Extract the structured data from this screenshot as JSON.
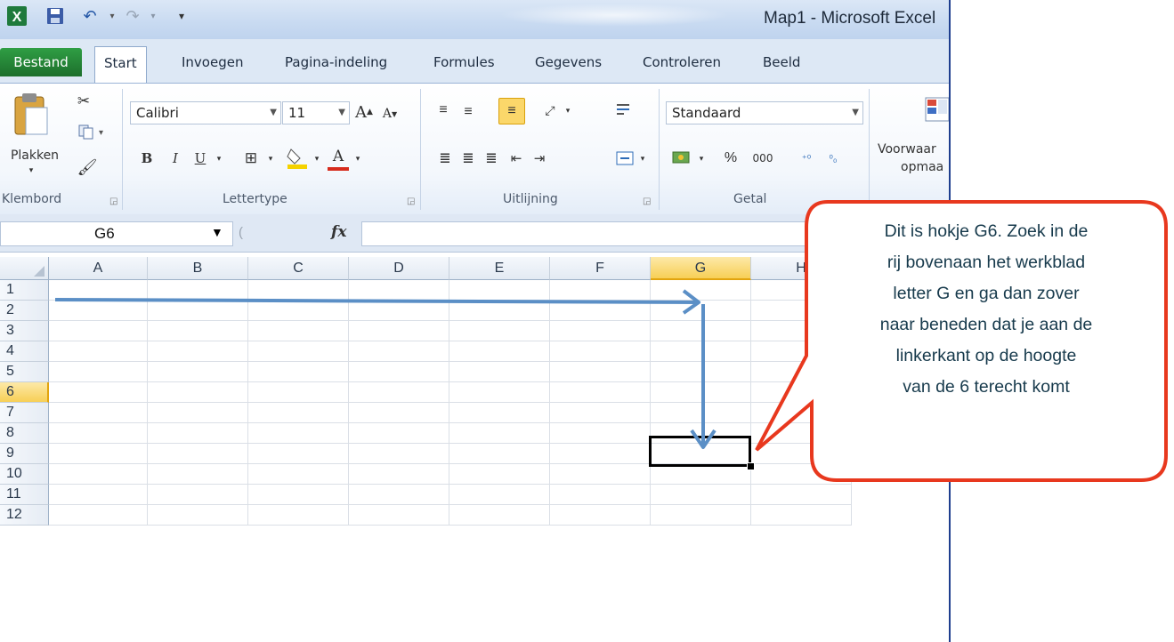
{
  "window": {
    "title": "Map1 - Microsoft Excel"
  },
  "quick_access": {
    "undo_icon": "undo-icon",
    "redo_icon": "redo-icon",
    "save_icon": "save-icon",
    "app_icon": "excel-icon",
    "customize": "▾"
  },
  "tabs": [
    {
      "label": "Bestand",
      "active": false,
      "file": true
    },
    {
      "label": "Start",
      "active": true
    },
    {
      "label": "Invoegen"
    },
    {
      "label": "Pagina-indeling"
    },
    {
      "label": "Formules"
    },
    {
      "label": "Gegevens"
    },
    {
      "label": "Controleren"
    },
    {
      "label": "Beeld"
    }
  ],
  "ribbon": {
    "clipboard": {
      "paste_label": "Plakken",
      "group_label": "Klembord"
    },
    "font": {
      "name": "Calibri",
      "size": "11",
      "bold": "B",
      "italic": "I",
      "underline": "U",
      "grow": "A",
      "shrink": "A",
      "color_a": "A",
      "group_label": "Lettertype"
    },
    "alignment": {
      "group_label": "Uitlijning"
    },
    "number": {
      "format": "Standaard",
      "percent": "%",
      "thousands": "000",
      "group_label": "Getal"
    },
    "styles": {
      "conditional_label_1": "Voorwaar",
      "conditional_label_2": "opmaa"
    }
  },
  "formula_bar": {
    "name_box": "G6",
    "fx_label": "fx",
    "value": ""
  },
  "grid": {
    "columns": [
      "A",
      "B",
      "C",
      "D",
      "E",
      "F",
      "G",
      "H"
    ],
    "rows": [
      "1",
      "2",
      "3",
      "4",
      "5",
      "6",
      "7",
      "8",
      "9",
      "10",
      "11",
      "12"
    ],
    "selected_column": "G",
    "selected_row": "6",
    "selected_cell": "G6"
  },
  "annotation": {
    "text_lines": [
      "Dit is hokje G6. Zoek in de",
      "rij bovenaan het werkblad",
      "letter G en ga dan zover",
      "naar beneden dat je aan de",
      "linkerkant op de hoogte",
      "van de 6 terecht komt"
    ],
    "callout_border_color": "#e8381e",
    "arrow_color": "#5b8fc6"
  }
}
